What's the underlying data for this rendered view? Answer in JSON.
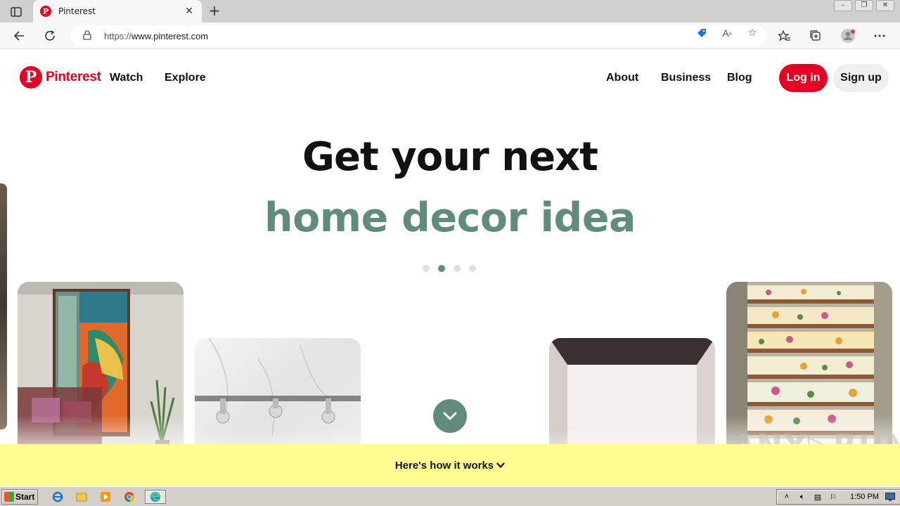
{
  "browser": {
    "tab_title": "Pinterest",
    "url_prefix": "https://",
    "url_host": "www.pinterest.com",
    "new_tab_glyph": "+",
    "close_glyph": "✕"
  },
  "nav": {
    "logo_text": "Pinterest",
    "logo_mark": "P",
    "links_left": [
      "Watch",
      "Explore"
    ],
    "links_right": [
      "About",
      "Business",
      "Blog"
    ],
    "login_label": "Log in",
    "signup_label": "Sign up"
  },
  "hero": {
    "line1": "Get your next",
    "line2": "home decor idea",
    "dot_count": 4,
    "active_dot": 1
  },
  "footer_banner": {
    "label": "Here's how it works"
  },
  "watermark": "ANY▷RUN",
  "taskbar": {
    "start_label": "Start",
    "clock": "1:50 PM"
  },
  "colors": {
    "brand_red": "#e60023",
    "hero_green": "#618c7b",
    "banner_yellow": "#fffd92"
  },
  "icons": [
    "sidebar-icon",
    "back-arrow-icon",
    "refresh-icon",
    "lock-icon",
    "tag-icon",
    "read-aloud-icon",
    "add-favorite-icon",
    "favorites-icon",
    "collections-icon",
    "profile-icon",
    "more-icon",
    "chevron-down-icon"
  ]
}
